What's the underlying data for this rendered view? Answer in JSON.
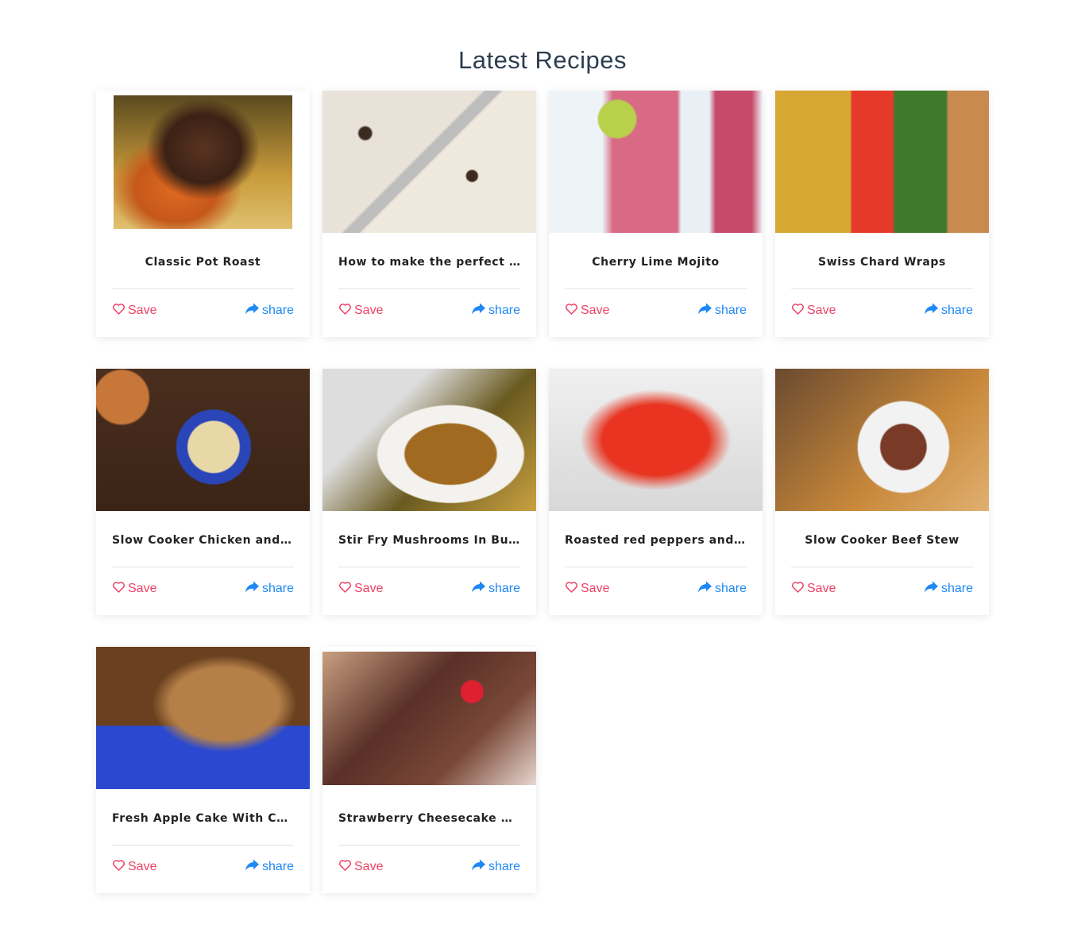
{
  "heading": "Latest Recipes",
  "save_label": "Save",
  "share_label": "share",
  "colors": {
    "save": "#ee4266",
    "share": "#1e88f5"
  },
  "recipes": [
    {
      "title": "Classic Pot Roast"
    },
    {
      "title": "How to make the perfect Ch..."
    },
    {
      "title": "Cherry Lime Mojito"
    },
    {
      "title": "Swiss Chard Wraps"
    },
    {
      "title": "Slow Cooker Chicken and Du..."
    },
    {
      "title": "Stir Fry Mushrooms In Butte..."
    },
    {
      "title": "Roasted red peppers and to..."
    },
    {
      "title": "Slow Cooker Beef Stew"
    },
    {
      "title": "Fresh Apple Cake With Cara..."
    },
    {
      "title": "Strawberry Cheesecake Choc..."
    }
  ]
}
